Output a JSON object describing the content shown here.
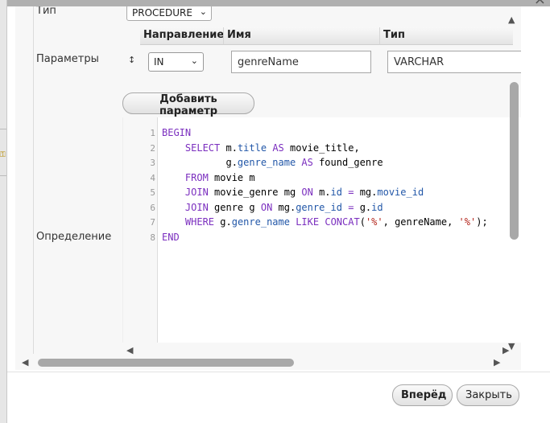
{
  "dialog": {
    "close_symbol": "×"
  },
  "form": {
    "type_label": "Тип",
    "type_value": "PROCEDURE",
    "params_label": "Параметры",
    "definition_label": "Определение"
  },
  "params": {
    "headers": {
      "direction": "Направление",
      "name": "Имя",
      "type": "Тип"
    },
    "rows": [
      {
        "direction": "IN",
        "name": "genreName",
        "type": "VARCHAR"
      }
    ],
    "add_button": "Добавить параметр"
  },
  "editor": {
    "line_numbers": [
      "1",
      "2",
      "3",
      "4",
      "5",
      "6",
      "7",
      "8"
    ],
    "lines": [
      [
        {
          "t": "BEGIN",
          "c": "kw"
        }
      ],
      [
        {
          "t": "    "
        },
        {
          "t": "SELECT",
          "c": "kw"
        },
        {
          "t": " m."
        },
        {
          "t": "title",
          "c": "fld"
        },
        {
          "t": " "
        },
        {
          "t": "AS",
          "c": "kw"
        },
        {
          "t": " movie_title,"
        }
      ],
      [
        {
          "t": "           g."
        },
        {
          "t": "genre_name",
          "c": "fld"
        },
        {
          "t": " "
        },
        {
          "t": "AS",
          "c": "kw"
        },
        {
          "t": " found_genre"
        }
      ],
      [
        {
          "t": "    "
        },
        {
          "t": "FROM",
          "c": "kw"
        },
        {
          "t": " movie m"
        }
      ],
      [
        {
          "t": "    "
        },
        {
          "t": "JOIN",
          "c": "kw"
        },
        {
          "t": " movie_genre mg "
        },
        {
          "t": "ON",
          "c": "kw"
        },
        {
          "t": " m."
        },
        {
          "t": "id",
          "c": "fld"
        },
        {
          "t": " "
        },
        {
          "t": "=",
          "c": "kw"
        },
        {
          "t": " mg."
        },
        {
          "t": "movie_id",
          "c": "fld"
        }
      ],
      [
        {
          "t": "    "
        },
        {
          "t": "JOIN",
          "c": "kw"
        },
        {
          "t": " genre g "
        },
        {
          "t": "ON",
          "c": "kw"
        },
        {
          "t": " mg."
        },
        {
          "t": "genre_id",
          "c": "fld"
        },
        {
          "t": " "
        },
        {
          "t": "=",
          "c": "kw"
        },
        {
          "t": " g."
        },
        {
          "t": "id",
          "c": "fld"
        }
      ],
      [
        {
          "t": "    "
        },
        {
          "t": "WHERE",
          "c": "kw"
        },
        {
          "t": " g."
        },
        {
          "t": "genre_name",
          "c": "fld"
        },
        {
          "t": " "
        },
        {
          "t": "LIKE",
          "c": "kw"
        },
        {
          "t": " "
        },
        {
          "t": "CONCAT",
          "c": "kw"
        },
        {
          "t": "("
        },
        {
          "t": "'%'",
          "c": "str"
        },
        {
          "t": ", genreName, "
        },
        {
          "t": "'%'",
          "c": "str"
        },
        {
          "t": ");"
        }
      ],
      [
        {
          "t": "END",
          "c": "kw"
        }
      ]
    ]
  },
  "footer": {
    "next_button": "Вперёд",
    "close_button": "Закрыть"
  },
  "icons": {
    "sort": "↕",
    "chevron": "⌄",
    "up": "▲",
    "down": "▼",
    "left": "◀",
    "right": "▶"
  }
}
